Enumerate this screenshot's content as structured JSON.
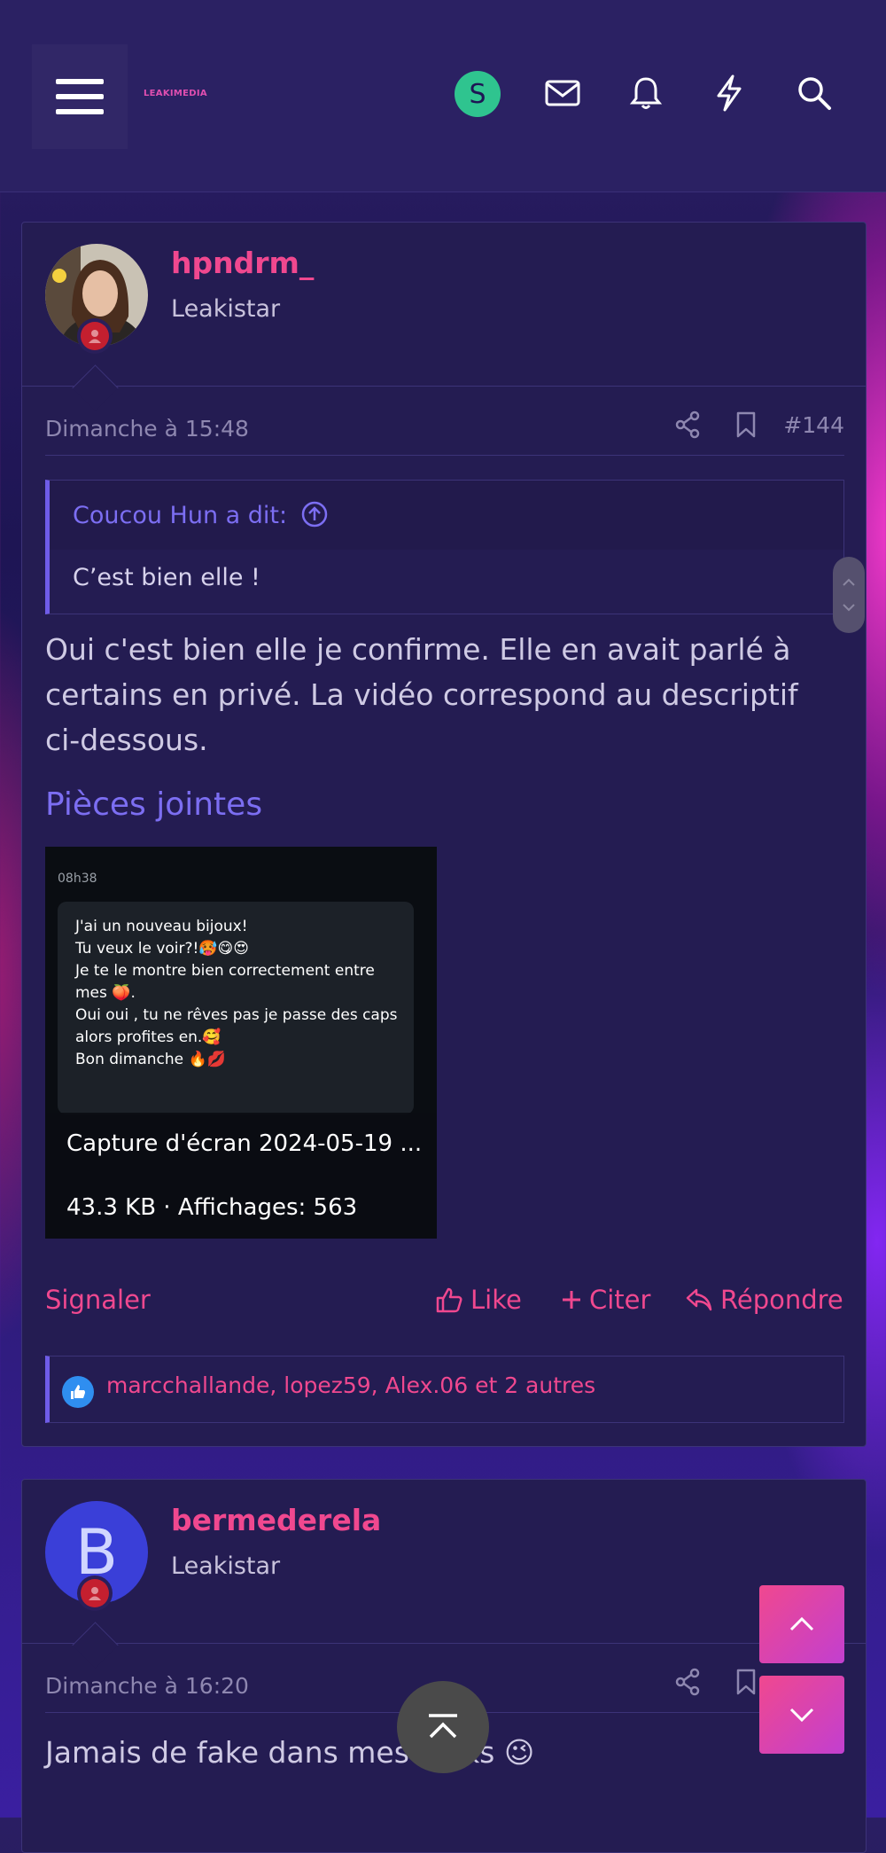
{
  "header": {
    "logo_text": "LEAKIMEDIA",
    "user_initial": "S"
  },
  "post1": {
    "username": "hpndrm_",
    "user_title": "Leakistar",
    "date": "Dimanche à 15:48",
    "post_number": "#144",
    "quote_author": "Coucou Hun a dit:",
    "quote_text": "C’est bien elle !",
    "body": "Oui c'est bien elle je confirme. Elle en avait parlé à certains en privé. La vidéo correspond au descriptif ci-dessous.",
    "attachments_title": "Pièces jointes",
    "attachment": {
      "time": "08h38",
      "lines": [
        "J'ai un nouveau bijoux!",
        "Tu veux le voir?!🥵😋😍",
        "Je te le montre bien correctement entre",
        "mes 🍑.",
        "Oui oui , tu ne rêves pas je passe des caps",
        "alors profites en.🥰",
        "Bon dimanche 🔥💋"
      ],
      "name": "Capture d'écran 2024-05-19 ...",
      "meta": "43.3 KB · Affichages: 563"
    },
    "report_label": "Signaler",
    "like_label": "Like",
    "quote_label": "Citer",
    "reply_label": "Répondre",
    "reactions_text": "marcchallande, lopez59, Alex.06 et 2 autres"
  },
  "post2": {
    "username": "bermederela",
    "user_title": "Leakistar",
    "avatar_letter": "B",
    "date": "Dimanche à 16:20",
    "body": "Jamais de fake dans mes leaks 😉"
  }
}
